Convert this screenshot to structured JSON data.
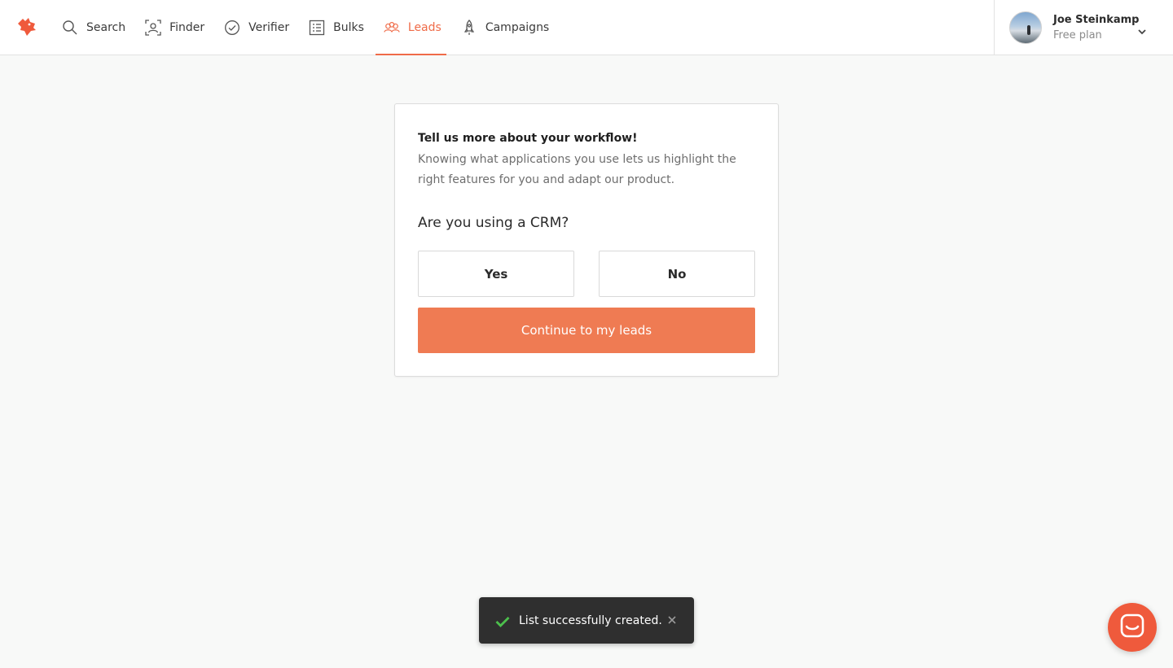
{
  "nav": {
    "items": [
      {
        "label": "Search",
        "icon": "search-icon"
      },
      {
        "label": "Finder",
        "icon": "finder-icon"
      },
      {
        "label": "Verifier",
        "icon": "check-circle-icon"
      },
      {
        "label": "Bulks",
        "icon": "list-icon"
      },
      {
        "label": "Leads",
        "icon": "leads-icon",
        "active": true
      },
      {
        "label": "Campaigns",
        "icon": "rocket-icon"
      }
    ],
    "accent_color": "#ef6b48"
  },
  "user": {
    "name": "Joe Steinkamp",
    "plan": "Free plan"
  },
  "card": {
    "title": "Tell us more about your workflow!",
    "description": "Knowing what applications you use lets us highlight the right features for you and adapt our product.",
    "question": "Are you using a CRM?",
    "yes_label": "Yes",
    "no_label": "No",
    "continue_label": "Continue to my leads",
    "button_color": "#ef7b53"
  },
  "toast": {
    "message": "List successfully created.",
    "close_glyph": "✕"
  }
}
